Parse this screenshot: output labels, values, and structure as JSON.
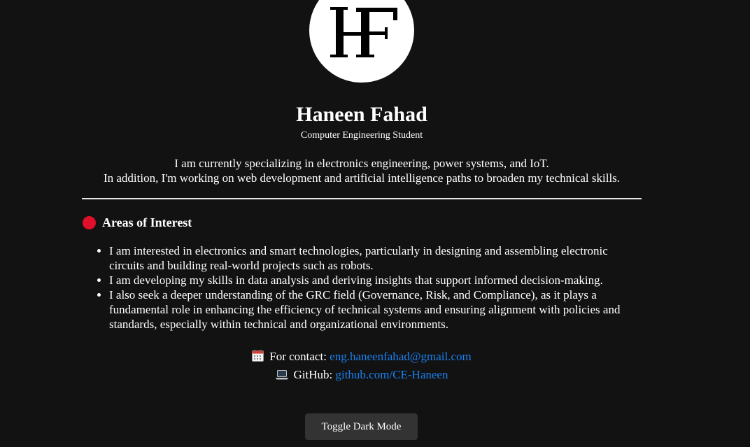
{
  "profile": {
    "logo_icon": "hf-monogram-logo",
    "name": "Haneen Fahad",
    "subtitle": "Computer Engineering Student",
    "intro_lines": [
      "I am currently specializing in electronics engineering, power systems, and IoT.",
      "In addition, I'm working on web development and artificial intelligence paths to broaden my technical skills."
    ]
  },
  "interests": {
    "icon": "red-circle-icon",
    "icon_color": "#e0102a",
    "title": "Areas of Interest",
    "items": [
      "I am interested in electronics and smart technologies, particularly in designing and assembling electronic circuits and building real-world projects such as robots.",
      "I am developing my skills in data analysis and deriving insights that support informed decision-making.",
      "I also seek a deeper understanding of the GRC field (Governance, Risk, and Compliance), as it plays a fundamental role in enhancing the efficiency of technical systems and ensuring alignment with policies and standards, especially within technical and organizational environments."
    ]
  },
  "contact": {
    "email_icon": "calendar-icon",
    "email_label": "For contact:",
    "email_value": "eng.haneenfahad@gmail.com",
    "github_icon": "laptop-icon",
    "github_label": "GitHub:",
    "github_value": "github.com/CE-Haneen",
    "link_color": "#1a80f0"
  },
  "theme": {
    "background": "#121212",
    "text": "#ffffff",
    "button_bg": "#333333"
  },
  "toggle_label": "Toggle Dark Mode"
}
